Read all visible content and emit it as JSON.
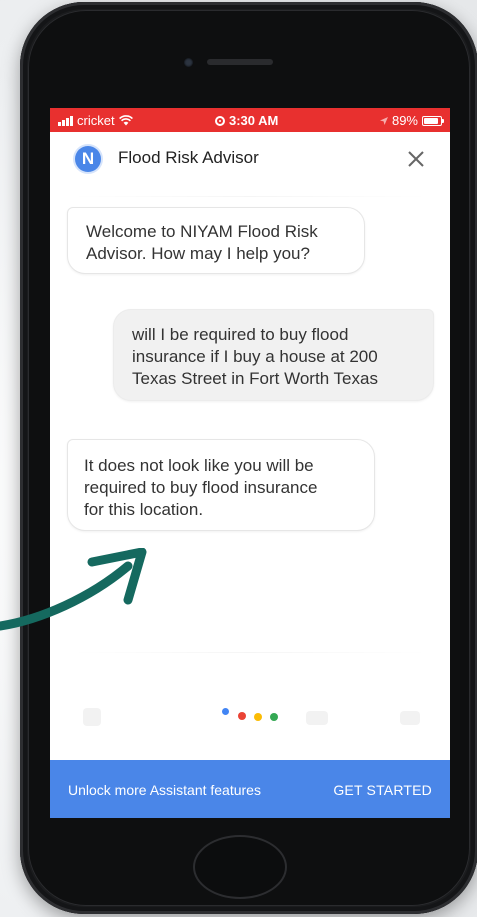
{
  "status_bar": {
    "carrier": "cricket",
    "time": "3:30 AM",
    "battery_percent_label": "89%",
    "battery_level": 0.89,
    "background_color": "#e8302f"
  },
  "header": {
    "logo_letter": "N",
    "title": "Flood Risk Advisor",
    "close_icon": "close-icon"
  },
  "messages": [
    {
      "sender": "bot",
      "lines": [
        "Welcome to NIYAM Flood Risk",
        "Advisor. How may I help you?"
      ]
    },
    {
      "sender": "user",
      "lines": [
        "will I be required to buy flood",
        "insurance if I buy a house at 200",
        "Texas Street in Fort Worth Texas"
      ]
    },
    {
      "sender": "bot",
      "lines": [
        "It does not look like you will be",
        "required to buy flood insurance",
        "for this location."
      ]
    }
  ],
  "assistant_indicator": {
    "colors": [
      "#4285f4",
      "#ea4335",
      "#fbbc05",
      "#34a853"
    ]
  },
  "footer": {
    "text": "Unlock more Assistant features",
    "button_label": "GET STARTED",
    "background_color": "#4a86e8"
  },
  "annotation_arrow": {
    "color": "#15695f"
  }
}
